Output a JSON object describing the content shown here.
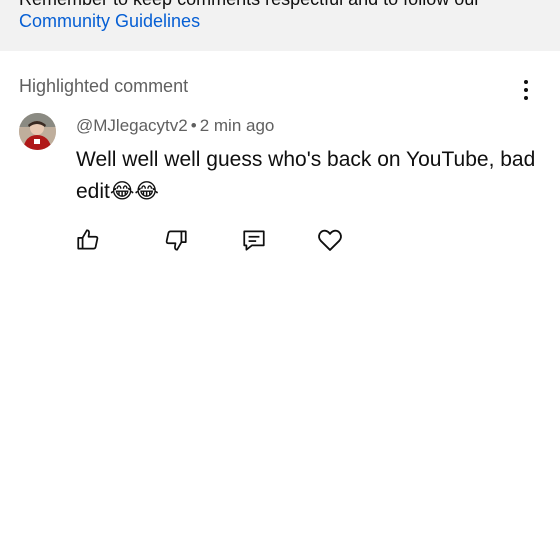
{
  "banner": {
    "text": "Remember to keep comments respectful and to follow our",
    "link": "Community Guidelines"
  },
  "section": {
    "title": "Highlighted comment"
  },
  "comment": {
    "author": "@MJlegacytv2",
    "separator": "•",
    "time": "2 min ago",
    "text": "Well well well guess who's back on YouTube, bad edit😂😂"
  },
  "icons": {
    "more": "more-vert-icon",
    "like": "thumb-up-icon",
    "dislike": "thumb-down-icon",
    "reply": "reply-comment-icon",
    "heart": "heart-icon"
  },
  "colors": {
    "banner_bg": "#f2f2f2",
    "link": "#065fd4",
    "secondary_text": "#606060",
    "primary_text": "#0f0f0f"
  }
}
